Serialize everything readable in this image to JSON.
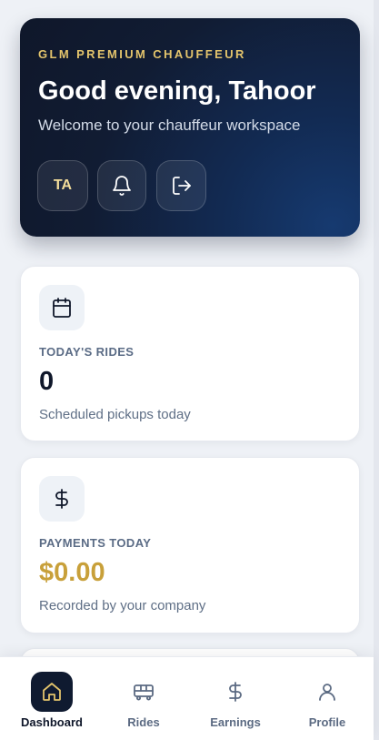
{
  "hero": {
    "brand": "GLM PREMIUM CHAUFFEUR",
    "greeting": "Good evening, Tahoor",
    "subtitle": "Welcome to your chauffeur workspace",
    "avatar_initials": "TA",
    "icons": [
      "bell-icon",
      "logout-icon"
    ]
  },
  "cards": {
    "rides": {
      "icon": "calendar-icon",
      "label": "TODAY'S RIDES",
      "value": "0",
      "caption": "Scheduled pickups today"
    },
    "payments": {
      "icon": "dollar-icon",
      "label": "PAYMENTS TODAY",
      "value": "$0.00",
      "caption": "Recorded by your company",
      "value_color": "#c8a03a"
    }
  },
  "nav": {
    "active": "dashboard",
    "items": [
      {
        "key": "dashboard",
        "label": "Dashboard",
        "icon": "home-icon"
      },
      {
        "key": "rides",
        "label": "Rides",
        "icon": "bus-icon"
      },
      {
        "key": "earnings",
        "label": "Earnings",
        "icon": "dollar-icon"
      },
      {
        "key": "profile",
        "label": "Profile",
        "icon": "user-icon"
      }
    ]
  },
  "colors": {
    "navy": "#0f172a",
    "gold": "#e3c46c",
    "page_bg": "#eef1f6"
  }
}
